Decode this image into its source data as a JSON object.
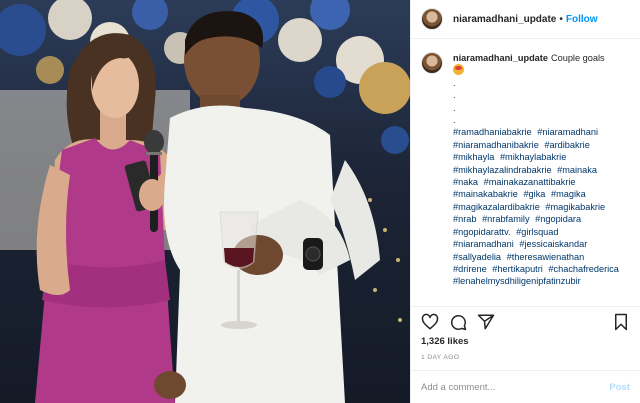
{
  "post": {
    "username": "niaramadhani_update",
    "follow_label": "Follow",
    "header_dot": "•",
    "caption": "Couple goals",
    "caption_dots": [
      ".",
      ".",
      ".",
      "."
    ],
    "hashtags": [
      "#ramadhaniabakrie",
      "#niaramadhani",
      "#niaramadhanibakrie",
      "#ardibakrie",
      "#mikhayla",
      "#mikhaylabakrie",
      "#mikhaylazalindrabakrie",
      "#mainaka",
      "#naka",
      "#mainakazanattibakrie",
      "#mainakabakrie",
      "#gika",
      "#magika",
      "#magikazalardibakrie",
      "#magikabakrie",
      "#nrab",
      "#nrabfamily",
      "#ngopidara",
      "#ngopidarattv.",
      "#girlsquad",
      "#niaramadhani",
      "#jessicaiskandar",
      "#sallyadelia",
      "#theresawienathan",
      "#drirene",
      "#hertikaputri",
      "#chachafrederica",
      "#lenahelmysdhiligenipfatinzubir"
    ],
    "likes": "1,326 likes",
    "time_ago": "1 DAY AGO",
    "comment_placeholder": "Add a comment...",
    "post_label": "Post"
  },
  "colors": {
    "link_blue": "#0095f6",
    "hashtag": "#00376b",
    "text": "#262626",
    "muted": "#8e8e8e",
    "post_disabled": "#b2dffc",
    "dress": "#b0398a"
  },
  "icons": {
    "like": "heart-icon",
    "comment": "comment-icon",
    "share": "share-icon",
    "save": "bookmark-icon",
    "emoji": "star-struck-emoji-icon"
  }
}
